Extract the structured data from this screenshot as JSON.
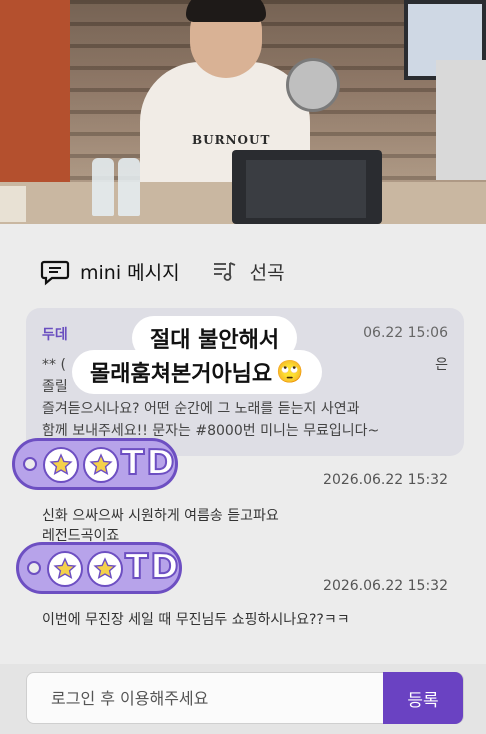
{
  "tabs": [
    {
      "label": "mini 메시지",
      "icon": "chat-bubble-icon"
    },
    {
      "label": "선곡",
      "icon": "music-list-icon"
    }
  ],
  "highlight_message": {
    "name": "두데",
    "time": "06.22 15:06",
    "text_prefix": "** (",
    "text_suffix": "은",
    "line2": "졸릴",
    "line3": "즐겨듣으시나요? 어떤 순간에 그 노래를 듣는지 사연과",
    "line4": "함께 보내주세요!! 문자는 #8000번 미니는 무료입니다~"
  },
  "messages": [
    {
      "time": "2026.06.22 15:32",
      "line1": "신화 으싸으싸    시원하게  여름송  듣고파요",
      "line2": "레전드곡이죠"
    },
    {
      "time": "2026.06.22 15:32",
      "line1": "이번에 무진장 세일 때 무진님두 쇼핑하시나요??ㅋㅋ"
    }
  ],
  "overlay": {
    "line1": "절대 불안해서",
    "line2": "몰래훔쳐본거아님요",
    "emoji": "🙄"
  },
  "stickers": [
    {
      "letters": "TD"
    },
    {
      "letters": "TD"
    }
  ],
  "photo": {
    "shirt_text": "BURNOUT"
  },
  "input": {
    "placeholder": "로그인 후 이용해주세요",
    "submit_label": "등록"
  },
  "colors": {
    "accent": "#6a42c2",
    "tag_fill": "#b7a3ea",
    "name": "#6a4fc0"
  }
}
